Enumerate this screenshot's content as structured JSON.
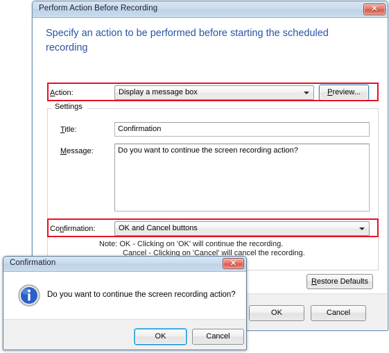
{
  "main_window": {
    "title": "Perform Action Before Recording",
    "close_icon": "close-icon",
    "heading": "Specify an action to be performed before starting the scheduled recording",
    "action_row": {
      "label_pre": "",
      "label_accel": "A",
      "label_post": "ction:",
      "combo_value": "Display a message box",
      "preview_button_pre": "",
      "preview_button_accel": "P",
      "preview_button_post": "review...",
      "highlight_color": "#e81123"
    },
    "settings_group": {
      "legend": "Settings",
      "title_field": {
        "label_accel": "T",
        "label_post": "itle:",
        "value": "Confirmation"
      },
      "message_field": {
        "label_accel": "M",
        "label_post": "essage:",
        "value": "Do you want to continue the screen recording action?"
      },
      "confirmation_field": {
        "label_pre": "Co",
        "label_accel": "n",
        "label_post": "firmation:",
        "value": "OK and Cancel buttons"
      },
      "note_line_1": "Note: OK - Clicking on 'OK' will continue the recording.",
      "note_line_2": "Cancel - Clicking on 'Cancel' will cancel the recording."
    },
    "restore_defaults_button": {
      "accel": "R",
      "post": "estore Defaults"
    },
    "ok_button": "OK",
    "cancel_button": "Cancel"
  },
  "confirmation_dialog": {
    "title": "Confirmation",
    "close_icon": "close-icon",
    "icon": "info-icon",
    "message": "Do you want to continue the screen recording action?",
    "ok_button": "OK",
    "cancel_button": "Cancel"
  }
}
